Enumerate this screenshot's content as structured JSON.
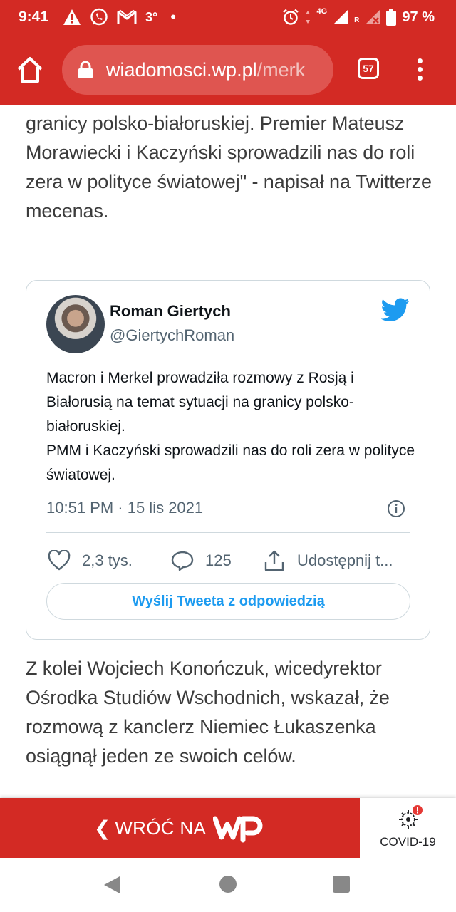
{
  "status_bar": {
    "time": "9:41",
    "temperature": "3°",
    "network": "4G",
    "battery": "97 %",
    "roaming": "R"
  },
  "browser": {
    "url_host": "wiadomosci.wp.pl",
    "url_path": "/merk",
    "tab_count": "57"
  },
  "article": {
    "paragraph_1": "granicy polsko-białoruskiej. Premier Mateusz Morawiecki i Kaczyński sprowadzili nas do roli zera w polityce światowej\" -  napisał na Twitterze mecenas.",
    "paragraph_2": "Z kolei Wojciech Konończuk, wicedyrektor Ośrodka Studiów Wschodnich, wskazał, że rozmową z kanclerz Niemiec Łukaszenka osiągnął jeden ze swoich celów."
  },
  "tweet": {
    "author_name": "Roman Giertych",
    "author_handle": "@GiertychRoman",
    "text_line_1": "Macron i Merkel prowadziła rozmowy z Rosją i Białorusią na temat sytuacji na granicy polsko-białoruskiej.",
    "text_line_2": "PMM i Kaczyński sprowadzili nas do roli zera w polityce światowej.",
    "timestamp": "10:51 PM · 15 lis 2021",
    "likes": "2,3 tys.",
    "replies": "125",
    "share_label": "Udostępnij t...",
    "reply_button": "Wyślij Tweeta z odpowiedzią"
  },
  "bottom_banner": {
    "back_label": "WRÓĆ NA",
    "covid_label": "COVID-19"
  },
  "colors": {
    "brand_red": "#d32a24",
    "twitter_blue": "#1d9bf0"
  },
  "icons": [
    "warning-icon",
    "whatsapp-icon",
    "gmail-icon",
    "alarm-icon",
    "signal-icon",
    "battery-icon",
    "home-icon",
    "lock-icon",
    "tabs-icon",
    "menu-icon",
    "twitter-icon",
    "info-icon",
    "heart-icon",
    "reply-icon",
    "share-icon",
    "covid-icon"
  ]
}
